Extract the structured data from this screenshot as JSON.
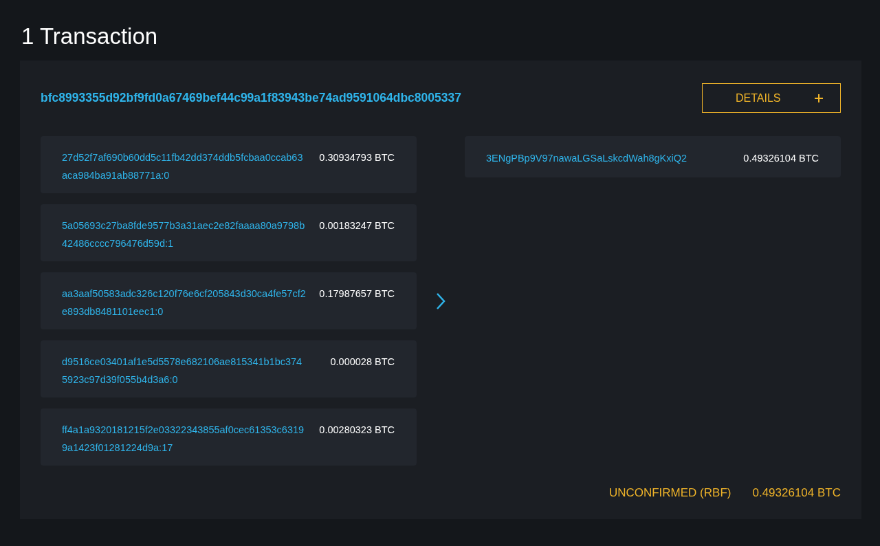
{
  "heading": "1 Transaction",
  "transaction": {
    "hash": "bfc8993355d92bf9fd0a67469bef44c99a1f83943be74ad9591064dbc8005337",
    "details_button": "DETAILS",
    "inputs": [
      {
        "address": "27d52f7af690b60dd5c11fb42dd374ddb5fcbaa0ccab63aca984ba91ab88771a:0",
        "amount": "0.30934793 BTC"
      },
      {
        "address": "5a05693c27ba8fde9577b3a31aec2e82faaaa80a9798b42486cccc796476d59d:1",
        "amount": "0.00183247 BTC"
      },
      {
        "address": "aa3aaf50583adc326c120f76e6cf205843d30ca4fe57cf2e893db8481101eec1:0",
        "amount": "0.17987657 BTC"
      },
      {
        "address": "d9516ce03401af1e5d5578e682106ae815341b1bc3745923c97d39f055b4d3a6:0",
        "amount": "0.000028 BTC"
      },
      {
        "address": "ff4a1a9320181215f2e03322343855af0cec61353c63199a1423f01281224d9a:17",
        "amount": "0.00280323 BTC"
      }
    ],
    "outputs": [
      {
        "address": "3ENgPBp9V97nawaLGSaLskcdWah8gKxiQ2",
        "amount": "0.49326104 BTC"
      }
    ],
    "status": "UNCONFIRMED (RBF)",
    "total": "0.49326104 BTC"
  }
}
